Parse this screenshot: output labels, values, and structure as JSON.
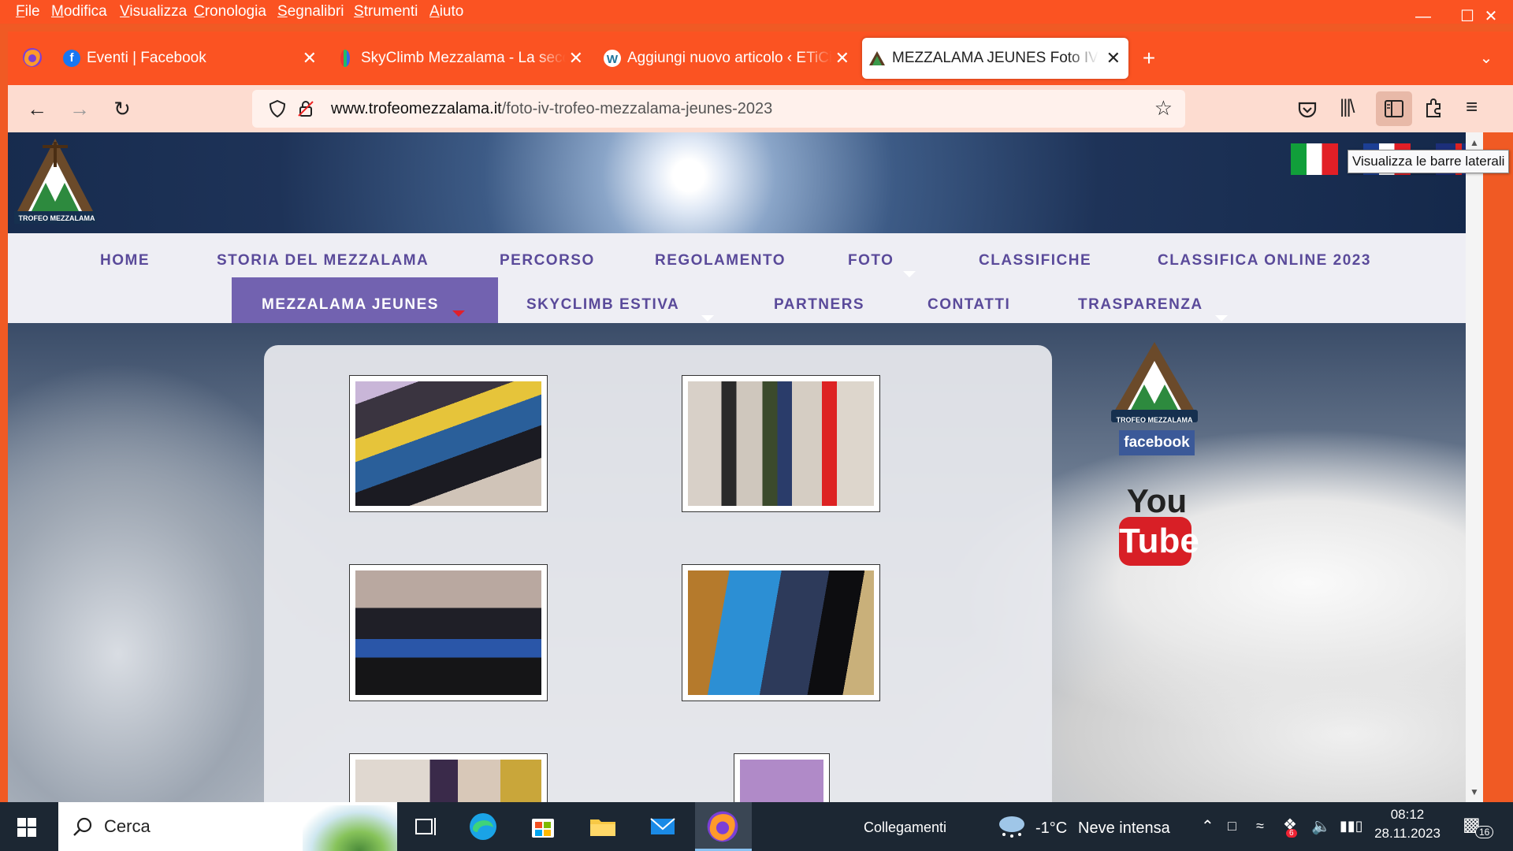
{
  "menu": [
    "File",
    "Modifica",
    "Visualizza",
    "Cronologia",
    "Segnalibri",
    "Strumenti",
    "Aiuto"
  ],
  "tabs": [
    {
      "title": "Eventi | Facebook"
    },
    {
      "title": "SkyClimb Mezzalama - La seconda"
    },
    {
      "title": "Aggiungi nuovo articolo ‹ ETiCinema"
    },
    {
      "title": "MEZZALAMA JEUNES Foto IV Trofeo"
    }
  ],
  "url": {
    "domain": "www.trofeomezzalama.it",
    "path": "/foto-iv-trofeo-mezzalama-jeunes-2023"
  },
  "site": {
    "logo_text": "TROFEO MEZZALAMA",
    "nav_row1": [
      "HOME",
      "STORIA DEL MEZZALAMA",
      "PERCORSO",
      "REGOLAMENTO",
      "FOTO",
      "CLASSIFICHE",
      "CLASSIFICA ONLINE 2023"
    ],
    "nav_row2": [
      "MEZZALAMA JEUNES",
      "SKYCLIMB ESTIVA",
      "PARTNERS",
      "CONTATTI",
      "TRASPARENZA"
    ],
    "sidebar": {
      "logo_text": "TROFEO MEZZALAMA",
      "facebook": "facebook",
      "youtube_you": "You",
      "youtube_tube": "Tube"
    }
  },
  "tooltip": "Visualizza le barre laterali",
  "taskbar": {
    "search": "Cerca",
    "links": "Collegamenti",
    "weather_temp": "-1°C",
    "weather_desc": "Neve intensa",
    "time": "08:12",
    "date": "28.11.2023",
    "notifications": "16",
    "badge": "6"
  },
  "colors": {
    "browser_accent": "#fb5322",
    "nav_text": "#5a4a9a",
    "nav_active": "#7262b0"
  }
}
